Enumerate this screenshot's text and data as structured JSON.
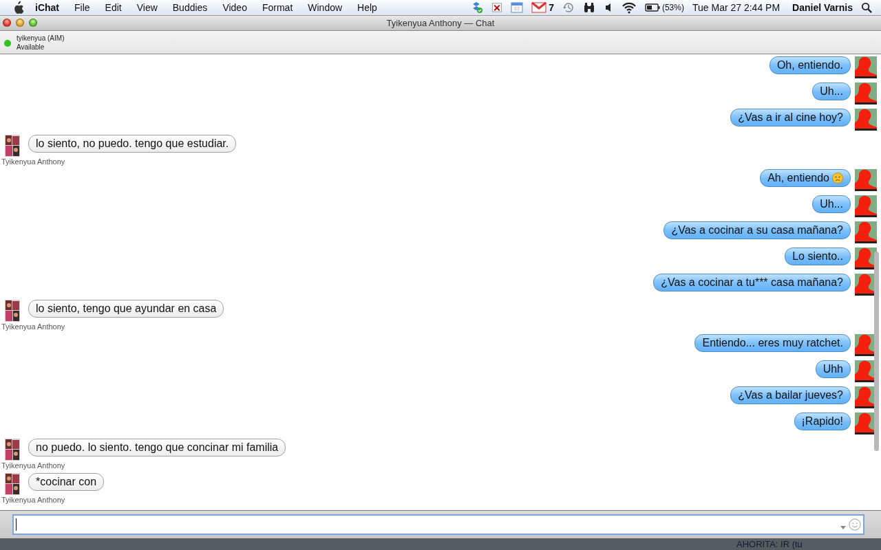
{
  "menu_bar": {
    "app": "iChat",
    "menus": [
      "File",
      "Edit",
      "View",
      "Buddies",
      "Video",
      "Format",
      "Window",
      "Help"
    ],
    "mail_count": "7",
    "battery": "(53%)",
    "clock": "Tue Mar 27  2:44 PM",
    "user": "Daniel Varnis"
  },
  "window": {
    "title": "Tyikenyua Anthony — Chat"
  },
  "buddy": {
    "name": "tyikenyua (AIM)",
    "status": "Available",
    "color": "#2fc41c"
  },
  "messages": [
    {
      "kind": "sent",
      "text": "Oh, entiendo."
    },
    {
      "kind": "sent",
      "text": "Uh..."
    },
    {
      "kind": "sent",
      "text": "¿Vas a ir al cine hoy?"
    },
    {
      "kind": "received",
      "text": "lo siento, no puedo. tengo que estudiar.",
      "sender": "Tyikenyua Anthony"
    },
    {
      "kind": "sent",
      "text": "Ah, entiendo",
      "emoticon": true
    },
    {
      "kind": "sent",
      "text": "Uh..."
    },
    {
      "kind": "sent",
      "text": "¿Vas a cocinar a su casa mañana?"
    },
    {
      "kind": "sent",
      "text": "Lo siento.."
    },
    {
      "kind": "sent",
      "text": "¿Vas a cocinar a tu*** casa mañana?"
    },
    {
      "kind": "received",
      "text": "lo siento, tengo que ayundar en casa",
      "sender": "Tyikenyua Anthony"
    },
    {
      "kind": "sent",
      "text": "Entiendo... eres muy ratchet."
    },
    {
      "kind": "sent",
      "text": "Uhh"
    },
    {
      "kind": "sent",
      "text": "¿Vas a bailar jueves?"
    },
    {
      "kind": "sent",
      "text": "¡Rapido!"
    },
    {
      "kind": "received",
      "text": "no puedo. lo siento. tengo que concinar mi familia",
      "sender": "Tyikenyua Anthony"
    },
    {
      "kind": "received",
      "text": "*cocinar con",
      "sender": "Tyikenyua Anthony"
    }
  ],
  "desktop": {
    "text": "AHORITA:  IR (tu"
  }
}
